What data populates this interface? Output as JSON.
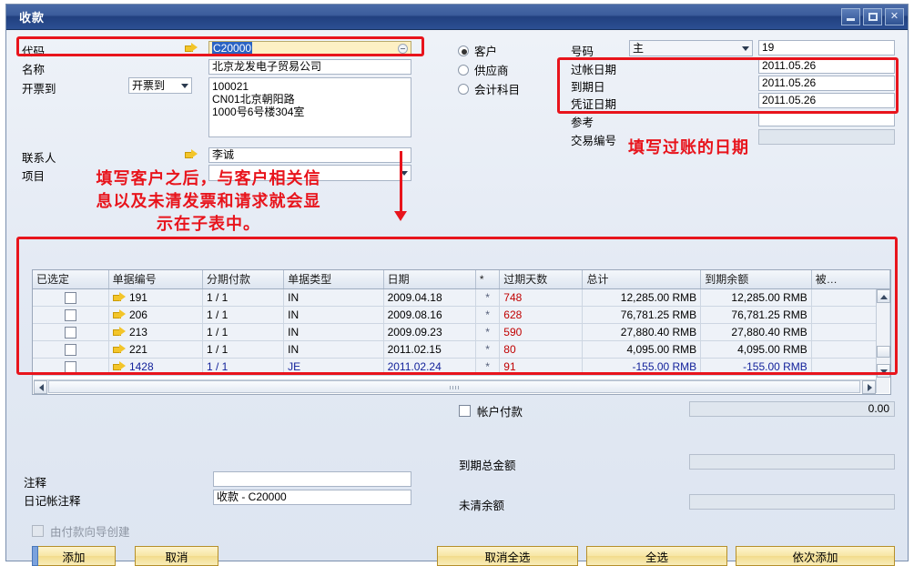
{
  "window": {
    "title": "收款",
    "buttons": {
      "minimize": "_",
      "maximize": "□",
      "close": "✕"
    }
  },
  "left_form": {
    "code_label": "代码",
    "code_value": "C20000",
    "name_label": "名称",
    "name_value": "北京龙发电子贸易公司",
    "billto_label": "开票到",
    "billto_select": "开票到",
    "address_lines": [
      "100021",
      "CN01北京朝阳路",
      "1000号6号楼304室"
    ],
    "contact_label": "联系人",
    "contact_value": "李诚",
    "project_label": "项目",
    "project_value": ""
  },
  "payee_type": {
    "options": [
      {
        "label": "客户",
        "selected": true
      },
      {
        "label": "供应商",
        "selected": false
      },
      {
        "label": "会计科目",
        "selected": false
      }
    ]
  },
  "right_form": {
    "number_label": "号码",
    "number_series": "主",
    "number_value": "19",
    "posting_date_label": "过帐日期",
    "posting_date_value": "2011.05.26",
    "due_date_label": "到期日",
    "due_date_value": "2011.05.26",
    "document_date_label": "凭证日期",
    "document_date_value": "2011.05.26",
    "reference_label": "参考",
    "reference_value": "",
    "transaction_no_label": "交易编号",
    "transaction_no_value": ""
  },
  "grid": {
    "columns": [
      "已选定",
      "单据编号",
      "分期付款",
      "单据类型",
      "日期",
      "*",
      "过期天数",
      "总计",
      "到期余额",
      "被…"
    ],
    "rows": [
      {
        "selected": false,
        "doc_no": "191",
        "installment": "1 / 1",
        "doc_type": "IN",
        "date": "2009.04.18",
        "star": "*",
        "overdue_days": "748",
        "total": "12,285.00 RMB",
        "balance_due": "12,285.00 RMB",
        "blocked": "",
        "blue": false
      },
      {
        "selected": false,
        "doc_no": "206",
        "installment": "1 / 1",
        "doc_type": "IN",
        "date": "2009.08.16",
        "star": "*",
        "overdue_days": "628",
        "total": "76,781.25 RMB",
        "balance_due": "76,781.25 RMB",
        "blocked": "",
        "blue": false
      },
      {
        "selected": false,
        "doc_no": "213",
        "installment": "1 / 1",
        "doc_type": "IN",
        "date": "2009.09.23",
        "star": "*",
        "overdue_days": "590",
        "total": "27,880.40 RMB",
        "balance_due": "27,880.40 RMB",
        "blocked": "",
        "blue": false
      },
      {
        "selected": false,
        "doc_no": "221",
        "installment": "1 / 1",
        "doc_type": "IN",
        "date": "2011.02.15",
        "star": "*",
        "overdue_days": "80",
        "total": "4,095.00 RMB",
        "balance_due": "4,095.00 RMB",
        "blocked": "",
        "blue": false
      },
      {
        "selected": false,
        "doc_no": "1428",
        "installment": "1 / 1",
        "doc_type": "JE",
        "date": "2011.02.24",
        "star": "*",
        "overdue_days": "91",
        "total": "-155.00 RMB",
        "balance_due": "-155.00 RMB",
        "blocked": "",
        "blue": true
      }
    ]
  },
  "totals": {
    "account_payment_label": "帐户付款",
    "account_payment_checked": false,
    "account_payment_value": "0.00",
    "total_due_label": "到期总金额",
    "total_due_value": "",
    "open_balance_label": "未清余额",
    "open_balance_value": ""
  },
  "remarks": {
    "remarks_label": "注释",
    "remarks_value": "",
    "journal_remarks_label": "日记帐注释",
    "journal_remarks_value": "收款 - C20000"
  },
  "footer": {
    "wizard_checkbox_label": "由付款向导创建",
    "wizard_checked": false,
    "add_button": "添加",
    "cancel_button": "取消",
    "deselect_all_button": "取消全选",
    "select_all_button": "全选",
    "add_sequential_button": "依次添加"
  },
  "annotations": {
    "note_customer": "填写客户之后，与客户相关信\n息以及未清发票和请求就会显\n示在子表中。",
    "note_posting_date": "填写过账的日期"
  },
  "colors": {
    "annotation_red": "#e8141c",
    "title_blue": "#2c4f93",
    "button_yellow": "#f7e6a4",
    "overdue_red": "#c00000",
    "row_blue": "#13229b",
    "highlight_field": "#fdf0c4"
  }
}
